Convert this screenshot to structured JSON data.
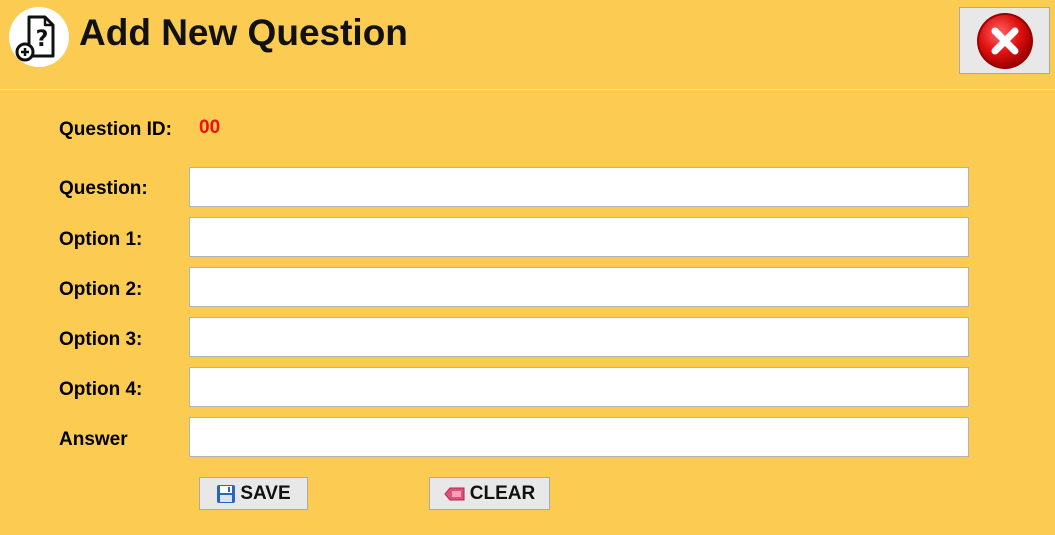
{
  "header": {
    "title": "Add New Question",
    "icon": "question-document-add-icon",
    "close_icon": "close-icon"
  },
  "question_id": {
    "label": "Question ID:",
    "value": "00"
  },
  "form": {
    "fields": [
      {
        "label": "Question:",
        "value": ""
      },
      {
        "label": "Option 1:",
        "value": ""
      },
      {
        "label": "Option 2:",
        "value": ""
      },
      {
        "label": "Option 3:",
        "value": ""
      },
      {
        "label": "Option 4:",
        "value": ""
      },
      {
        "label": "Answer",
        "value": ""
      }
    ]
  },
  "buttons": {
    "save_label": "SAVE",
    "save_icon": "floppy-disk-icon",
    "clear_label": "CLEAR",
    "clear_icon": "eraser-icon"
  },
  "colors": {
    "background": "#fbcb52",
    "id_value": "#ee1111",
    "close_red": "#e01010"
  }
}
